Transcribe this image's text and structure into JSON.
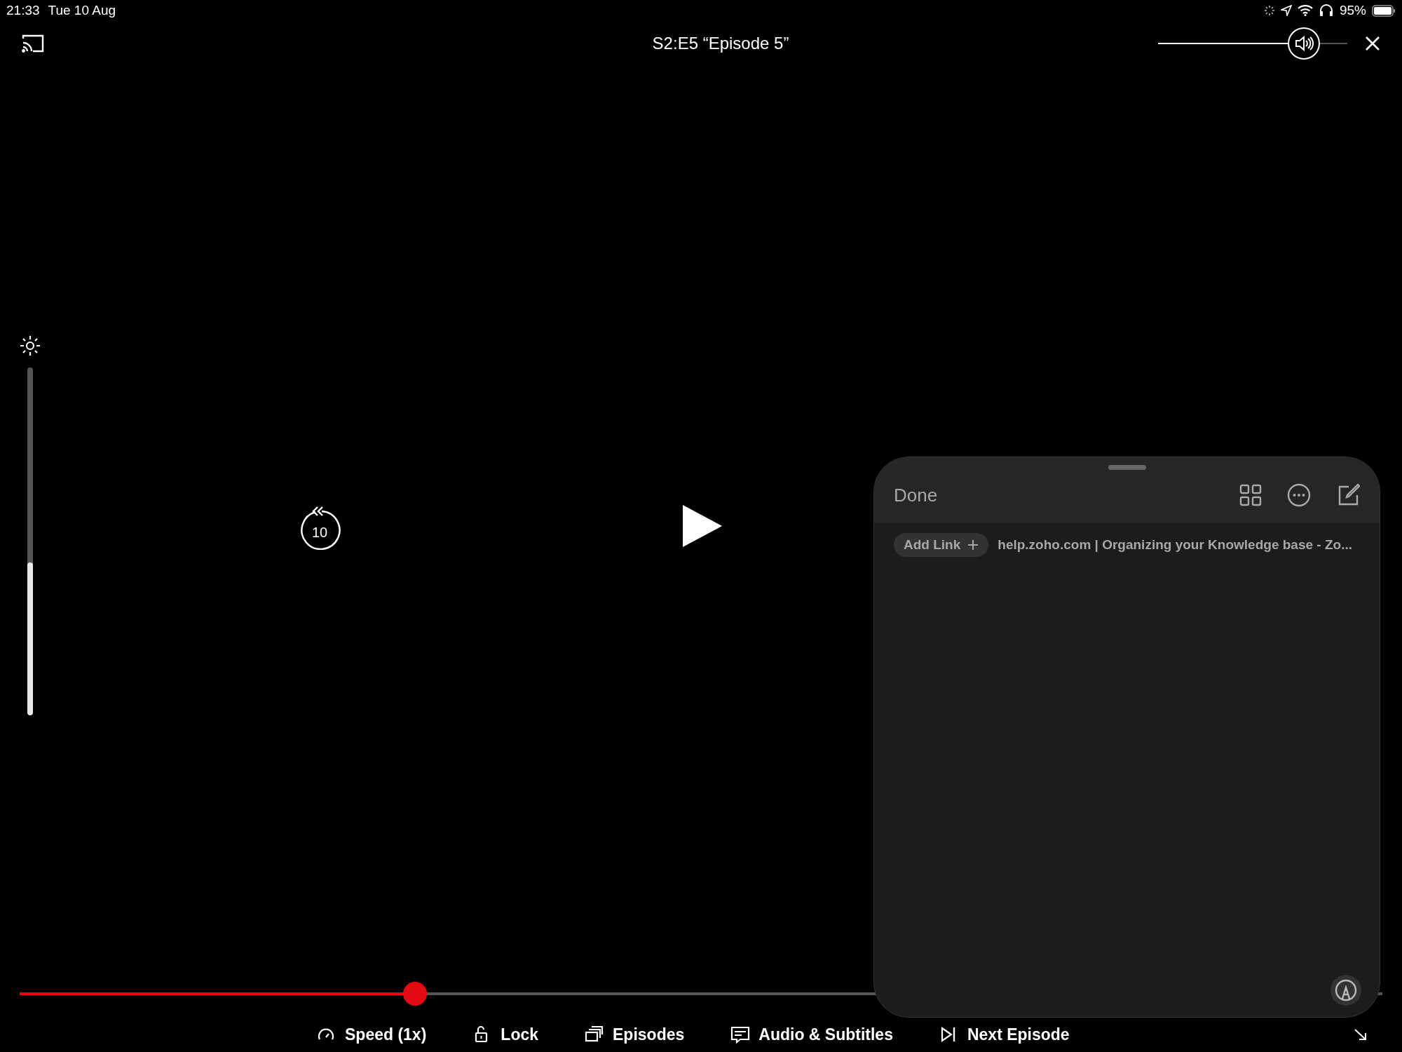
{
  "status_bar": {
    "time": "21:33",
    "date": "Tue 10 Aug",
    "battery": "95%"
  },
  "player": {
    "title": "S2:E5 “Episode 5”",
    "volume": {
      "level": 0.77
    },
    "brightness": {
      "level": 0.44
    },
    "skip_back": "10",
    "progress": {
      "level": 0.29
    },
    "controls": [
      {
        "kind": "speed",
        "label": "Speed (1x)"
      },
      {
        "kind": "lock",
        "label": "Lock"
      },
      {
        "kind": "episodes",
        "label": "Episodes"
      },
      {
        "kind": "subtitles",
        "label": "Audio & Subtitles"
      },
      {
        "kind": "next",
        "label": "Next Episode"
      }
    ]
  },
  "notes_panel": {
    "done": "Done",
    "add_link": "Add Link",
    "link_title": "help.zoho.com | Organizing your Knowledge base - Zo..."
  }
}
